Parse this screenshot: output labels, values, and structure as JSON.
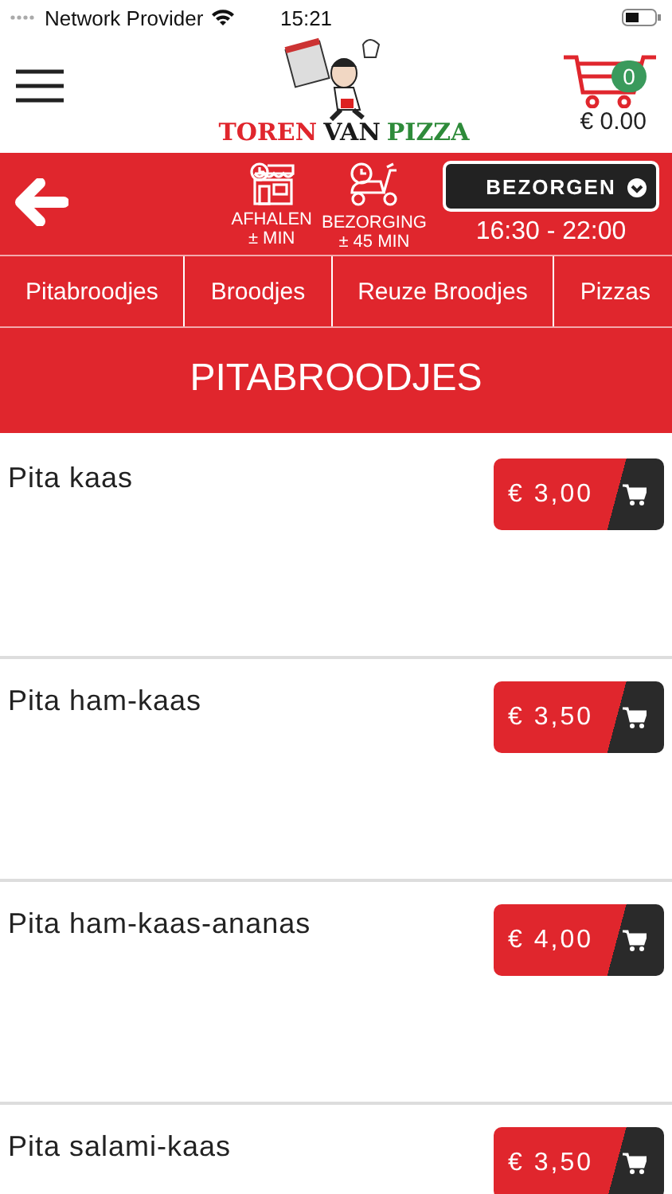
{
  "status_bar": {
    "carrier": "Network Provider",
    "time": "15:21"
  },
  "header": {
    "logo": [
      {
        "text": "TOREN",
        "color": "#e0262d"
      },
      {
        "text": "VAN",
        "color": "#1a1a1a"
      },
      {
        "text": "PIZZA",
        "color": "#2e8b3a"
      }
    ],
    "cart": {
      "count": "0",
      "total": "€ 0.00"
    }
  },
  "order_bar": {
    "options": [
      {
        "kind": "shop",
        "label": "AFHALEN",
        "time": "± MIN"
      },
      {
        "kind": "scooter",
        "label": "BEZORGING",
        "time": "± 45 MIN"
      }
    ],
    "mode": "BEZORGEN",
    "hours": "16:30 - 22:00"
  },
  "categories": [
    "Pitabroodjes",
    "Broodjes",
    "Reuze Broodjes",
    "Pizzas"
  ],
  "section_title": "PITABROODJES",
  "products": [
    {
      "name": "Pita kaas",
      "price": "€ 3,00"
    },
    {
      "name": "Pita ham-kaas",
      "price": "€ 3,50"
    },
    {
      "name": "Pita ham-kaas-ananas",
      "price": "€ 4,00"
    },
    {
      "name": "Pita salami-kaas",
      "price": "€ 3,50"
    }
  ]
}
